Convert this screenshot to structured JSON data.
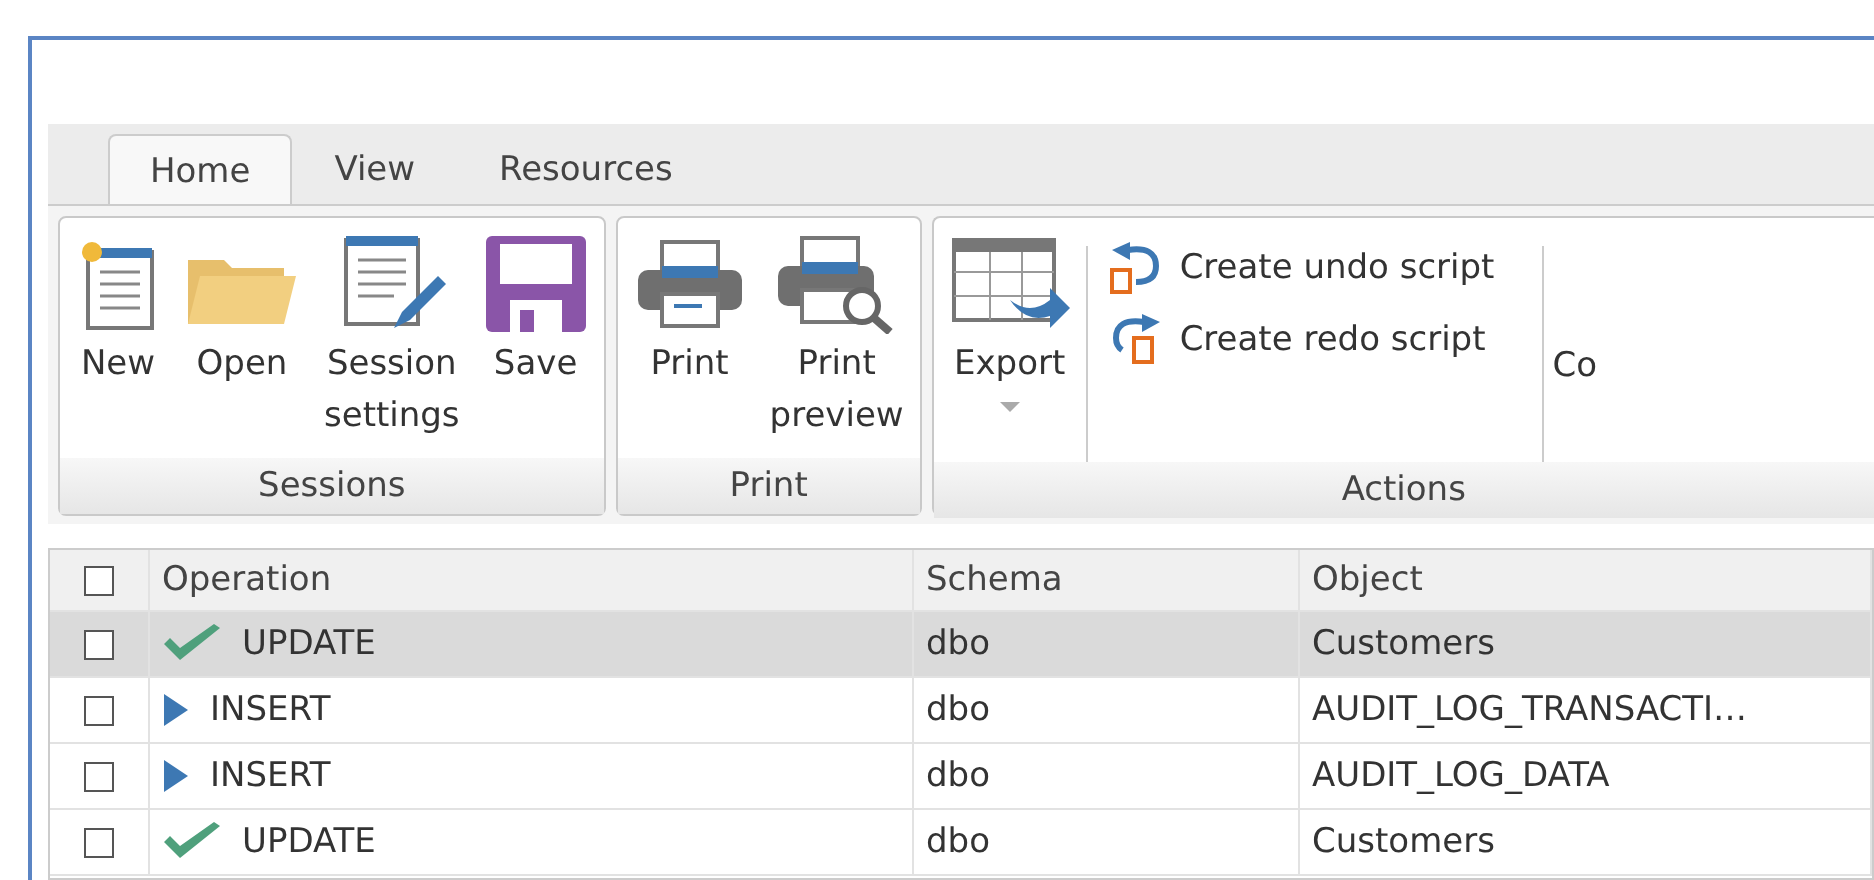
{
  "tabs": [
    {
      "label": "Home",
      "selected": true
    },
    {
      "label": "View",
      "selected": false
    },
    {
      "label": "Resources",
      "selected": false
    }
  ],
  "ribbon_groups": [
    {
      "label": "Sessions",
      "items": [
        {
          "kind": "new",
          "label": "New"
        },
        {
          "kind": "open",
          "label": "Open"
        },
        {
          "kind": "settings",
          "label": "Session settings"
        },
        {
          "kind": "save",
          "label": "Save"
        }
      ]
    },
    {
      "label": "Print",
      "items": [
        {
          "kind": "print",
          "label": "Print"
        },
        {
          "kind": "preview",
          "label": "Print preview"
        }
      ]
    },
    {
      "label": "Actions",
      "items": [
        {
          "kind": "export",
          "label": "Export"
        }
      ],
      "actions": [
        {
          "kind": "undo",
          "label": "Create undo script"
        },
        {
          "kind": "redo",
          "label": "Create redo script"
        }
      ],
      "cut_label": "Co"
    }
  ],
  "table": {
    "columns": [
      "Operation",
      "Schema",
      "Object"
    ],
    "header_checked": false,
    "rows": [
      {
        "selected": true,
        "checked": false,
        "kind": "done",
        "operation": "UPDATE",
        "schema": "dbo",
        "object": "Customers"
      },
      {
        "selected": false,
        "checked": false,
        "kind": "pending",
        "operation": "INSERT",
        "schema": "dbo",
        "object": "AUDIT_LOG_TRANSACTI…"
      },
      {
        "selected": false,
        "checked": false,
        "kind": "pending",
        "operation": "INSERT",
        "schema": "dbo",
        "object": "AUDIT_LOG_DATA"
      },
      {
        "selected": false,
        "checked": false,
        "kind": "done",
        "operation": "UPDATE",
        "schema": "dbo",
        "object": "Customers"
      }
    ]
  }
}
